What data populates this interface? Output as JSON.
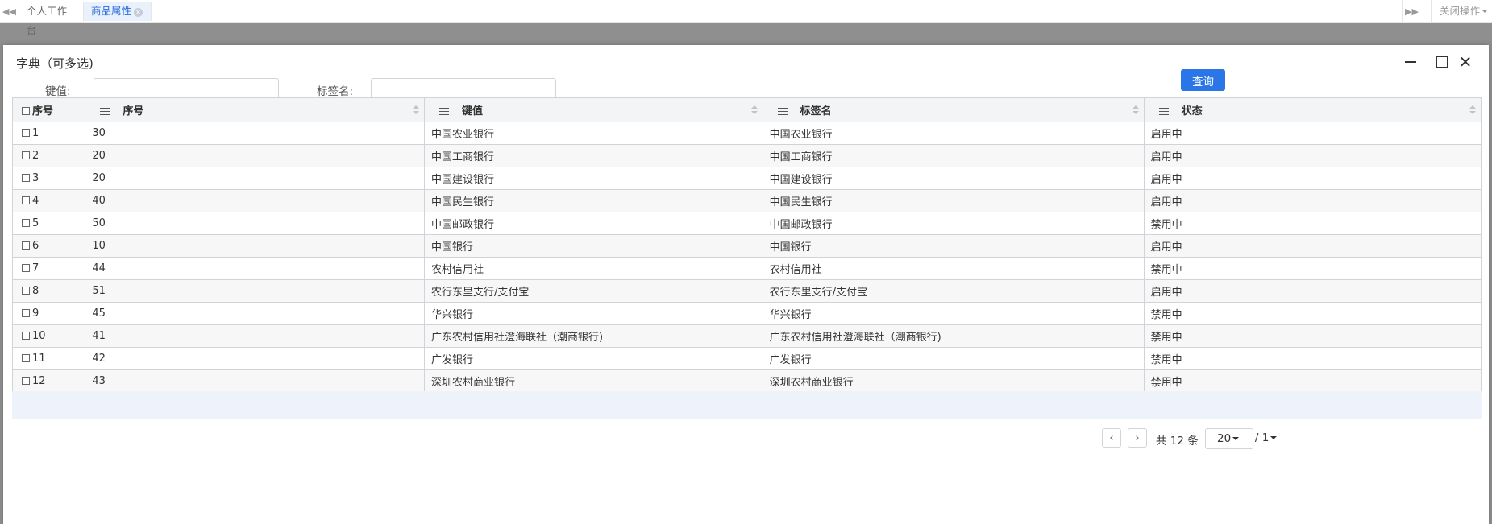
{
  "tabs": {
    "home": "个人工作台",
    "active": "商品属性",
    "close_ops": "关闭操作"
  },
  "dialog": {
    "title": "字典（可多选)",
    "search": {
      "key_label": "键值:",
      "key_value": "",
      "tag_label": "标签名:",
      "tag_value": "",
      "query_button": "查询"
    },
    "table": {
      "columns": [
        "序号",
        "序号",
        "键值",
        "标签名",
        "状态"
      ],
      "rows": [
        {
          "idx": "1",
          "seq": "30",
          "key": "中国农业银行",
          "label": "中国农业银行",
          "status": "启用中"
        },
        {
          "idx": "2",
          "seq": "20",
          "key": "中国工商银行",
          "label": "中国工商银行",
          "status": "启用中"
        },
        {
          "idx": "3",
          "seq": "20",
          "key": "中国建设银行",
          "label": "中国建设银行",
          "status": "启用中"
        },
        {
          "idx": "4",
          "seq": "40",
          "key": "中国民生银行",
          "label": "中国民生银行",
          "status": "启用中"
        },
        {
          "idx": "5",
          "seq": "50",
          "key": "中国邮政银行",
          "label": "中国邮政银行",
          "status": "禁用中"
        },
        {
          "idx": "6",
          "seq": "10",
          "key": "中国银行",
          "label": "中国银行",
          "status": "启用中"
        },
        {
          "idx": "7",
          "seq": "44",
          "key": "农村信用社",
          "label": "农村信用社",
          "status": "禁用中"
        },
        {
          "idx": "8",
          "seq": "51",
          "key": "农行东里支行/支付宝",
          "label": "农行东里支行/支付宝",
          "status": "启用中"
        },
        {
          "idx": "9",
          "seq": "45",
          "key": "华兴银行",
          "label": "华兴银行",
          "status": "禁用中"
        },
        {
          "idx": "10",
          "seq": "41",
          "key": "广东农村信用社澄海联社（潮商银行)",
          "label": "广东农村信用社澄海联社（潮商银行)",
          "status": "禁用中"
        },
        {
          "idx": "11",
          "seq": "42",
          "key": "广发银行",
          "label": "广发银行",
          "status": "禁用中"
        },
        {
          "idx": "12",
          "seq": "43",
          "key": "深圳农村商业银行",
          "label": "深圳农村商业银行",
          "status": "禁用中"
        }
      ]
    },
    "pager": {
      "page": "1 / 1",
      "prev": "‹",
      "next": "›",
      "total": "共 12 条",
      "page_size": "20"
    }
  }
}
